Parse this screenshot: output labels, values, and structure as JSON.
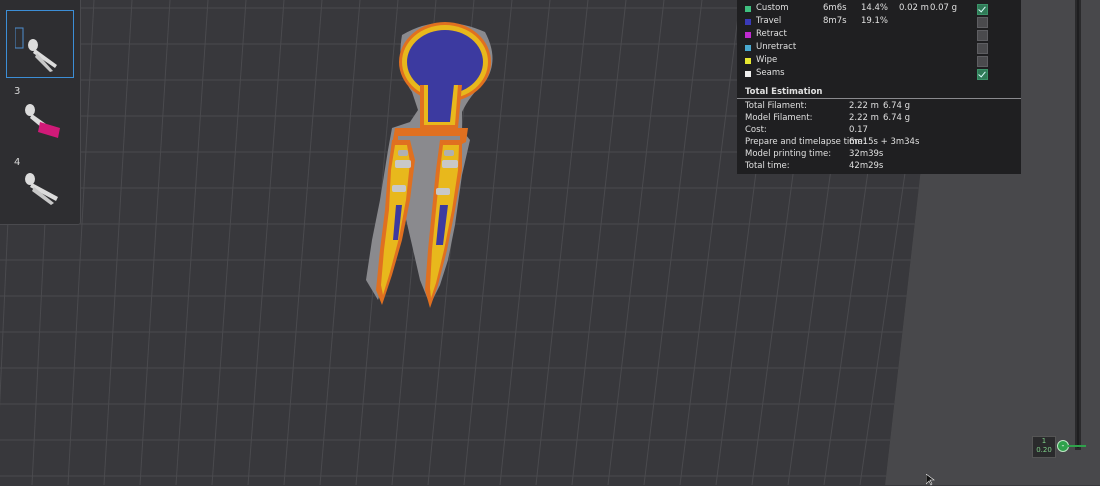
{
  "plates": [
    {
      "number": "",
      "selected": true
    },
    {
      "number": "3",
      "selected": false
    },
    {
      "number": "4",
      "selected": false
    }
  ],
  "legend": {
    "rows": [
      {
        "label": "Custom",
        "time": "6m6s",
        "percent": "14.4%",
        "length": "0.02 m",
        "weight": "0.07 g",
        "color": "#3fbf7f",
        "checked": true
      },
      {
        "label": "Travel",
        "time": "8m7s",
        "percent": "19.1%",
        "length": "",
        "weight": "",
        "color": "#3a3ab8",
        "checked": false
      },
      {
        "label": "Retract",
        "time": "",
        "percent": "",
        "length": "",
        "weight": "",
        "color": "#c02ad0",
        "checked": false
      },
      {
        "label": "Unretract",
        "time": "",
        "percent": "",
        "length": "",
        "weight": "",
        "color": "#49a9d0",
        "checked": false
      },
      {
        "label": "Wipe",
        "time": "",
        "percent": "",
        "length": "",
        "weight": "",
        "color": "#e8e832",
        "checked": false
      },
      {
        "label": "Seams",
        "time": "",
        "percent": "",
        "length": "",
        "weight": "",
        "color": "#f0f0f0",
        "checked": true
      }
    ]
  },
  "estimation": {
    "title": "Total Estimation",
    "rows": [
      {
        "key": "Total Filament:",
        "v1": "2.22 m",
        "v2": "6.74 g"
      },
      {
        "key": "Model Filament:",
        "v1": "2.22 m",
        "v2": "6.74 g"
      },
      {
        "key": "Cost:",
        "v1": "0.17",
        "v2": ""
      },
      {
        "key": "Prepare and timelapse time:",
        "v1": "6m15s + 3m34s",
        "v2": ""
      },
      {
        "key": "Model printing time:",
        "v1": "32m39s",
        "v2": ""
      },
      {
        "key": "Total time:",
        "v1": "42m29s",
        "v2": ""
      }
    ]
  },
  "slider": {
    "layer": "1",
    "height": "0.20",
    "knob_symbol": "-"
  },
  "colors": {
    "plate_bg": "#38383c",
    "grid_line": "#4c4c50",
    "infill": "#3c3aa0",
    "wall_inner": "#e8b81c",
    "wall_outer": "#e07020",
    "support": "#8a8a8e",
    "accent": "#3c8ed6"
  }
}
